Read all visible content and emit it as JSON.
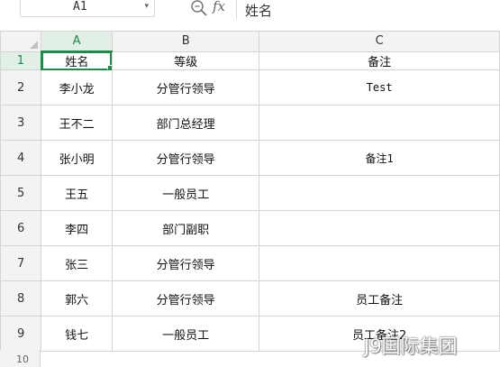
{
  "formula_bar": {
    "cell_ref": "A1",
    "fx_label": "fx",
    "content": "姓名",
    "zoom_icon": "magnifier-icon",
    "dropdown_icon": "caret-down-icon"
  },
  "columns": [
    "A",
    "B",
    "C"
  ],
  "rows": [
    {
      "num": "1",
      "name": "姓名",
      "level": "等级",
      "note": "备注"
    },
    {
      "num": "2",
      "name": "李小龙",
      "level": "分管行领导",
      "note": "Test"
    },
    {
      "num": "3",
      "name": "王不二",
      "level": "部门总经理",
      "note": ""
    },
    {
      "num": "4",
      "name": "张小明",
      "level": "分管行领导",
      "note": "备注1"
    },
    {
      "num": "5",
      "name": "王五",
      "level": "一般员工",
      "note": ""
    },
    {
      "num": "6",
      "name": "李四",
      "level": "部门副职",
      "note": ""
    },
    {
      "num": "7",
      "name": "张三",
      "level": "分管行领导",
      "note": ""
    },
    {
      "num": "8",
      "name": "郭六",
      "level": "分管行领导",
      "note": "员工备注"
    },
    {
      "num": "9",
      "name": "钱七",
      "level": "一般员工",
      "note": "员工备注2"
    }
  ],
  "partial_row_num": "10",
  "watermark": "J9国际集团",
  "colors": {
    "accent": "#1e8a4c",
    "header_bg": "#f3f3f3",
    "gridline": "#d4d4d4"
  }
}
